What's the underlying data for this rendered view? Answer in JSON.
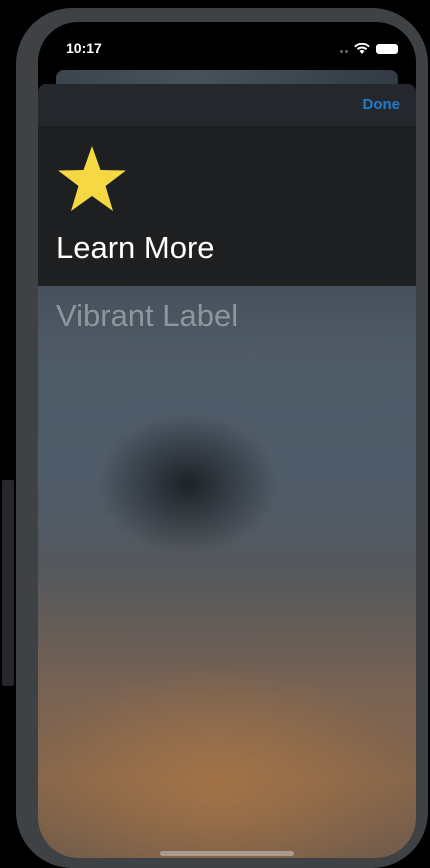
{
  "status_bar": {
    "time": "10:17"
  },
  "nav": {
    "done_label": "Done"
  },
  "header": {
    "icon": "star-icon",
    "title": "Learn More"
  },
  "content": {
    "vibrant_label": "Vibrant Label"
  },
  "colors": {
    "accent": "#1f7ccf",
    "star": "#f6d842",
    "header_background": "#1e1f21",
    "vibrant_text": "#8f959c"
  }
}
